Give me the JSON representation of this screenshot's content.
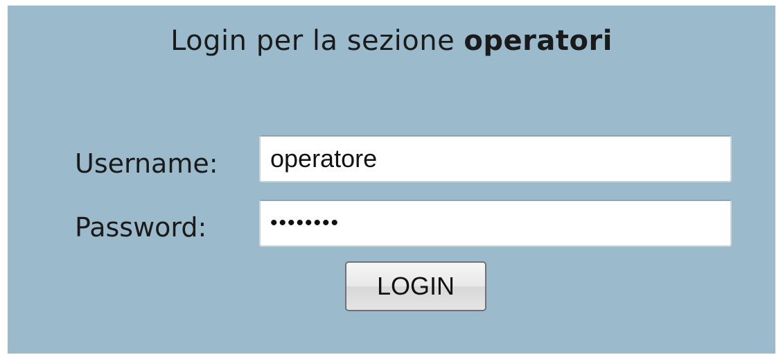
{
  "form": {
    "title_prefix": "Login per la sezione ",
    "title_bold": "operatori",
    "username_label": "Username:",
    "username_value": "operatore",
    "password_label": "Password:",
    "password_value": "operator",
    "login_button_label": "LOGIN"
  },
  "colors": {
    "panel_background": "#9bbacb"
  }
}
